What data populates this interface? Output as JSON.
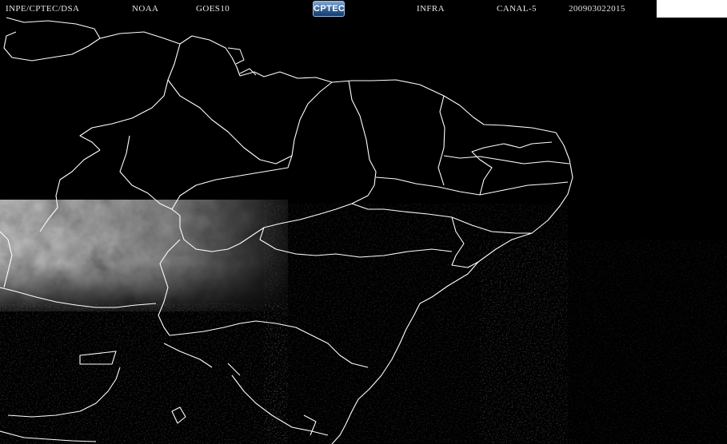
{
  "header": {
    "source": "INPE/CPTEC/DSA",
    "agency": "NOAA",
    "satellite": "GOES10",
    "logo_text": "CPTEC",
    "band": "INFRA",
    "channel": "CANAL-5",
    "timestamp": "200903022015"
  },
  "colors": {
    "background": "#000000",
    "borders": "#ffffff",
    "cloud": "#8a8a8a",
    "header_text": "#e6e6e6",
    "corner_box": "#ffffff"
  }
}
